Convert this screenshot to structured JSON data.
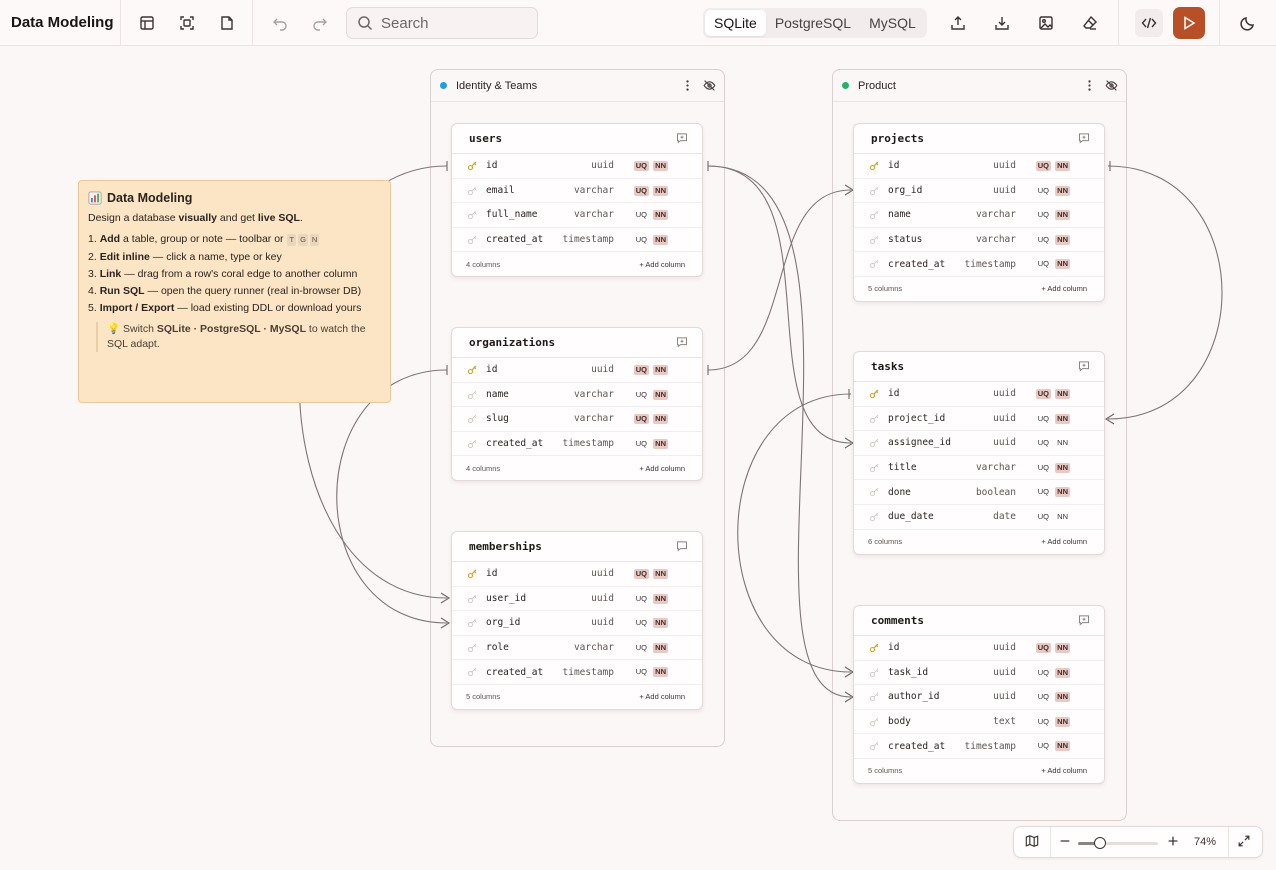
{
  "app": {
    "title": "Data Modeling"
  },
  "toolbar": {
    "search_placeholder": "Search",
    "dialects": [
      "SQLite",
      "PostgreSQL",
      "MySQL"
    ],
    "active_dialect": "SQLite",
    "icons": [
      "table-icon",
      "group-icon",
      "note-icon",
      "undo-icon",
      "redo-icon",
      "export-icon",
      "import-icon",
      "image-export-icon",
      "eraser-icon",
      "code-icon",
      "run-icon",
      "theme-icon"
    ],
    "accent": "#b84f27"
  },
  "groups": [
    {
      "name": "Identity & Teams",
      "color": "#1e9fe0"
    },
    {
      "name": "Product",
      "color": "#1fb36b"
    }
  ],
  "tables": {
    "users": {
      "name": "users",
      "columns": [
        {
          "name": "id",
          "type": "uuid",
          "uq": "UQ",
          "nn": "NN"
        },
        {
          "name": "email",
          "type": "varchar",
          "uq": "UQ",
          "nn": "NN"
        },
        {
          "name": "full_name",
          "type": "varchar",
          "uq": "UQ",
          "nn": "NN"
        },
        {
          "name": "created_at",
          "type": "timestamp",
          "uq": "UQ",
          "nn": "NN"
        }
      ],
      "count": "4 columns",
      "add": "Add column"
    },
    "organizations": {
      "name": "organizations",
      "columns": [
        {
          "name": "id",
          "type": "uuid",
          "uq": "UQ",
          "nn": "NN"
        },
        {
          "name": "name",
          "type": "varchar",
          "uq": "UQ",
          "nn": "NN"
        },
        {
          "name": "slug",
          "type": "varchar",
          "uq": "UQ",
          "nn": "NN"
        },
        {
          "name": "created_at",
          "type": "timestamp",
          "uq": "UQ",
          "nn": "NN"
        }
      ],
      "count": "4 columns",
      "add": "Add column"
    },
    "memberships": {
      "name": "memberships",
      "columns": [
        {
          "name": "id",
          "type": "uuid",
          "uq": "UQ",
          "nn": "NN"
        },
        {
          "name": "user_id",
          "type": "uuid",
          "uq": "UQ",
          "nn": "NN"
        },
        {
          "name": "org_id",
          "type": "uuid",
          "uq": "UQ",
          "nn": "NN"
        },
        {
          "name": "role",
          "type": "varchar",
          "uq": "UQ",
          "nn": "NN"
        },
        {
          "name": "created_at",
          "type": "timestamp",
          "uq": "UQ",
          "nn": "NN"
        }
      ],
      "count": "5 columns",
      "add": "Add column"
    },
    "projects": {
      "name": "projects",
      "columns": [
        {
          "name": "id",
          "type": "uuid",
          "uq": "UQ",
          "nn": "NN"
        },
        {
          "name": "org_id",
          "type": "uuid",
          "uq": "UQ",
          "nn": "NN"
        },
        {
          "name": "name",
          "type": "varchar",
          "uq": "UQ",
          "nn": "NN"
        },
        {
          "name": "status",
          "type": "varchar",
          "uq": "UQ",
          "nn": "NN"
        },
        {
          "name": "created_at",
          "type": "timestamp",
          "uq": "UQ",
          "nn": "NN"
        }
      ],
      "count": "5 columns",
      "add": "Add column"
    },
    "tasks": {
      "name": "tasks",
      "columns": [
        {
          "name": "id",
          "type": "uuid",
          "uq": "UQ",
          "nn": "NN"
        },
        {
          "name": "project_id",
          "type": "uuid",
          "uq": "UQ",
          "nn": "NN"
        },
        {
          "name": "assignee_id",
          "type": "uuid",
          "uq": "UQ",
          "nn": "NN"
        },
        {
          "name": "title",
          "type": "varchar",
          "uq": "UQ",
          "nn": "NN"
        },
        {
          "name": "done",
          "type": "boolean",
          "uq": "UQ",
          "nn": "NN"
        },
        {
          "name": "due_date",
          "type": "date",
          "uq": "UQ",
          "nn": "NN"
        }
      ],
      "count": "6 columns",
      "add": "Add column"
    },
    "comments": {
      "name": "comments",
      "columns": [
        {
          "name": "id",
          "type": "uuid",
          "uq": "UQ",
          "nn": "NN"
        },
        {
          "name": "task_id",
          "type": "uuid",
          "uq": "UQ",
          "nn": "NN"
        },
        {
          "name": "author_id",
          "type": "uuid",
          "uq": "UQ",
          "nn": "NN"
        },
        {
          "name": "body",
          "type": "text",
          "uq": "UQ",
          "nn": "NN"
        },
        {
          "name": "created_at",
          "type": "timestamp",
          "uq": "UQ",
          "nn": "NN"
        }
      ],
      "count": "5 columns",
      "add": "Add column"
    }
  },
  "note": {
    "title": "Data Modeling",
    "intro_a": "Design a database ",
    "intro_b": "visually",
    "intro_c": " and get ",
    "intro_d": "live SQL",
    "intro_e": ".",
    "step1_num": "1. ",
    "step1_b": "Add",
    "step1_t": " a table, group or note — toolbar or ",
    "step1_k1": "T",
    "step1_k2": "G",
    "step1_k3": "N",
    "step2_num": "2. ",
    "step2_b": "Edit inline",
    "step2_t": " — click a name, type or key",
    "step3_num": "3. ",
    "step3_b": "Link",
    "step3_t": " — drag from a row's coral edge to another column",
    "step4_num": "4. ",
    "step4_b": "Run SQL",
    "step4_t": " — open the query runner (real in-browser DB)",
    "step5_num": "5. ",
    "step5_b": "Import / Export",
    "step5_t": " — load existing DDL or download yours",
    "tip_a": "💡 Switch ",
    "tip_b": "SQLite · PostgreSQL · MySQL",
    "tip_c": " to watch the SQL adapt."
  },
  "zoom": {
    "percent_label": "74%",
    "level": 0.74
  }
}
